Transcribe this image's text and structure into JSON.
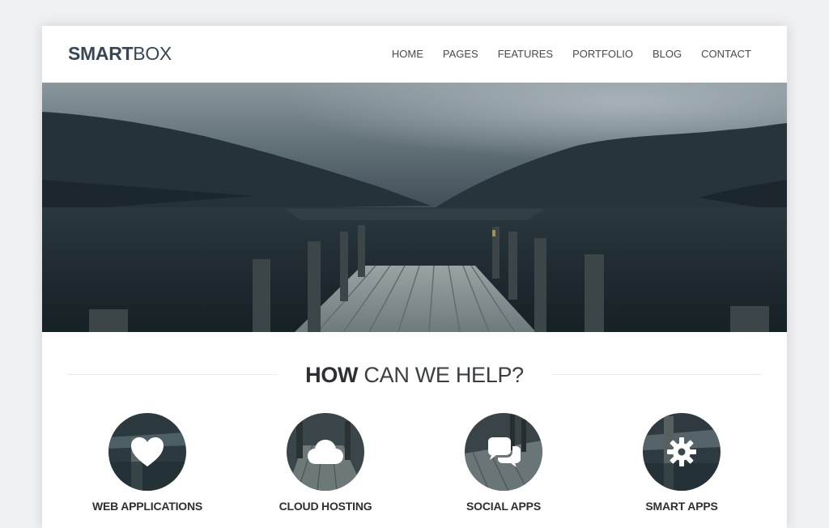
{
  "brand": {
    "bold": "SMART",
    "light": "BOX"
  },
  "nav": {
    "items": [
      {
        "label": "HOME"
      },
      {
        "label": "PAGES"
      },
      {
        "label": "FEATURES"
      },
      {
        "label": "PORTFOLIO"
      },
      {
        "label": "BLOG"
      },
      {
        "label": "CONTACT"
      }
    ]
  },
  "section": {
    "title_bold": "HOW",
    "title_light": "CAN WE HELP?"
  },
  "services": [
    {
      "label": "WEB APPLICATIONS",
      "icon": "heart-icon"
    },
    {
      "label": "CLOUD HOSTING",
      "icon": "cloud-icon"
    },
    {
      "label": "SOCIAL APPS",
      "icon": "chat-bubbles-icon"
    },
    {
      "label": "SMART APPS",
      "icon": "gear-icon"
    }
  ],
  "colors": {
    "brand": "#384755",
    "nav_text": "#444b52",
    "heading": "#2c3034",
    "background": "#eff0f2"
  }
}
